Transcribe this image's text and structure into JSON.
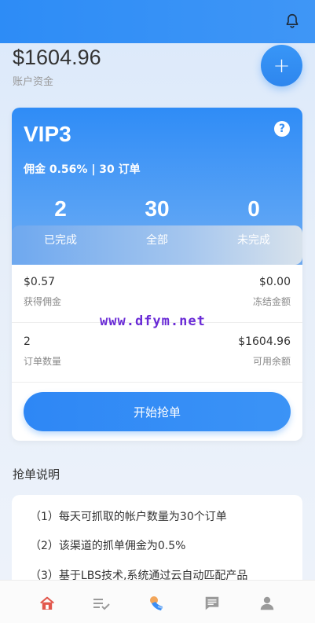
{
  "header": {
    "bell_icon": "bell-icon"
  },
  "account": {
    "amount": "$1604.96",
    "label": "账户资金"
  },
  "fab": {
    "label": "+"
  },
  "vip": {
    "title": "VIP3",
    "help": "?",
    "commission_line": "佣金 0.56% | 30 订单",
    "stats": [
      {
        "value": "2",
        "label": "已完成"
      },
      {
        "value": "30",
        "label": "全部"
      },
      {
        "value": "0",
        "label": "未完成"
      }
    ],
    "rows": [
      {
        "left_value": "$0.57",
        "left_label": "获得佣金",
        "right_value": "$0.00",
        "right_label": "冻结金额"
      },
      {
        "left_value": "2",
        "left_label": "订单数量",
        "right_value": "$1604.96",
        "right_label": "可用余额"
      }
    ],
    "start_button": "开始抢单"
  },
  "watermark": "www.dfym.net",
  "instructions": {
    "title": "抢单说明",
    "items": [
      "（1）每天可抓取的帐户数量为30个订单",
      "（2）该渠道的抓单佣金为0.5%",
      "（3）基于LBS技术,系统通过云自动匹配产品"
    ]
  },
  "tabs": [
    {
      "name": "home-icon",
      "color": "#e2574c"
    },
    {
      "name": "list-check-icon",
      "color": "#9a9a9a"
    },
    {
      "name": "grab-order-icon",
      "color": "#3a8ef5"
    },
    {
      "name": "message-icon",
      "color": "#9a9a9a"
    },
    {
      "name": "user-icon",
      "color": "#9a9a9a"
    }
  ]
}
